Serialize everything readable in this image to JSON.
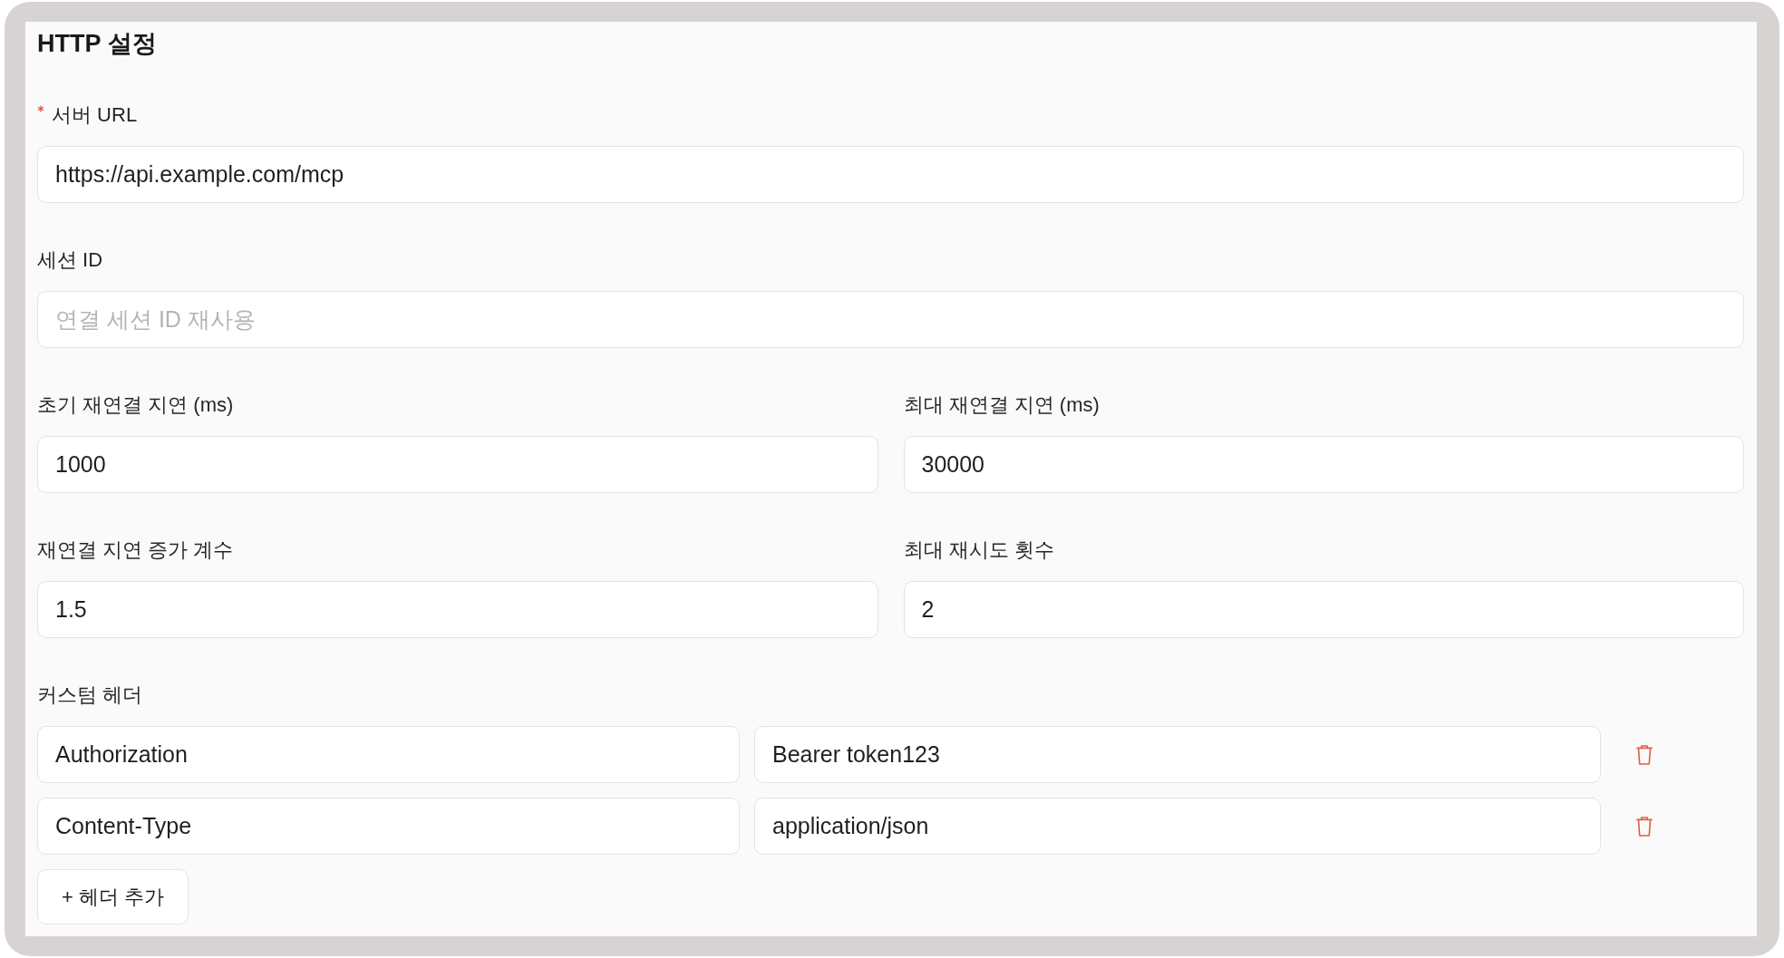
{
  "section": {
    "title": "HTTP 설정"
  },
  "form_rows": [
    {
      "fields": [
        {
          "label": "서버 URL",
          "required": true,
          "value": "https://api.example.com/mcp"
        }
      ]
    },
    {
      "fields": [
        {
          "label": "세션 ID",
          "required": false,
          "placeholder": "연결 세션 ID 재사용"
        }
      ]
    },
    {
      "fields": [
        {
          "label": "초기 재연결 지연 (ms)",
          "required": false,
          "value": "1000"
        },
        {
          "label": "최대 재연결 지연 (ms)",
          "required": false,
          "value": "30000"
        }
      ]
    },
    {
      "fields": [
        {
          "label": "재연결 지연 증가 계수",
          "required": false,
          "value": "1.5"
        },
        {
          "label": "최대 재시도 횟수",
          "required": false,
          "value": "2"
        }
      ]
    }
  ],
  "custom_headers": {
    "label": "커스텀 헤더",
    "rows": [
      {
        "name": "Authorization",
        "value": "Bearer token123"
      },
      {
        "name": "Content-Type",
        "value": "application/json"
      }
    ],
    "add_button": "+ 헤더 추가"
  }
}
